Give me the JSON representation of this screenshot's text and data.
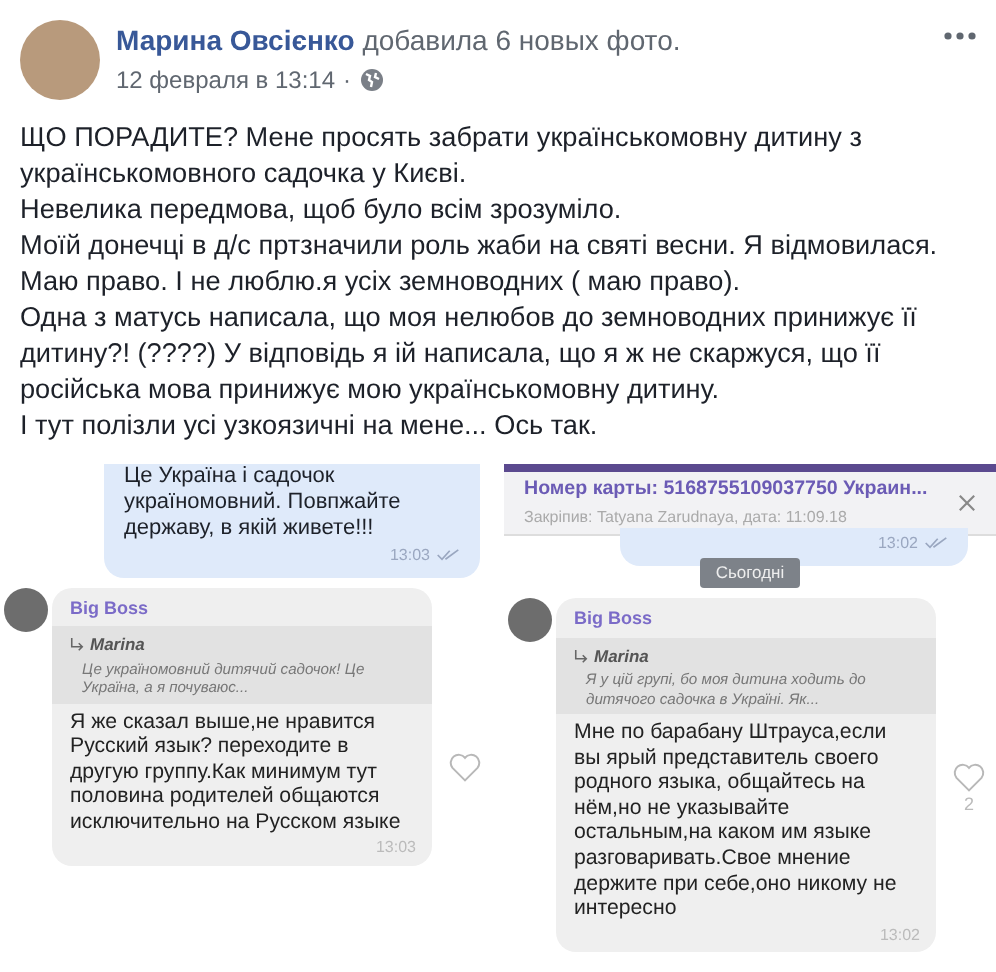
{
  "post": {
    "author": "Марина Овсієнко",
    "action": "добавила 6 новых фото.",
    "date": "12 февраля в 13:14",
    "separator": "·",
    "paragraphs": [
      "ЩО ПОРАДИТЕ? Мене просять забрати українськомовну дитину з українськомовного садочка у Києві.",
      "Невелика передмова, щоб було всім зрозуміло.",
      "Моїй донечці в д/с пртзначили роль жаби на святі весни. Я відмовилася.",
      "Маю право. І не люблю.я усіх земноводних ( маю право).",
      "Одна з матусь написала, що моя нелюбов до земноводних принижує її дитину?! (????) У відповідь я ій написала, що я ж не скаржуся, що її російська мова принижує мою українськомовну дитину.",
      "І тут полізли усі узкоязичні на мене... Ось так."
    ]
  },
  "screenshots": [
    {
      "outgoing": {
        "lines": [
          "Це Україна і садочок",
          "україномовний. Повпжайте державу, в якій живете!!!"
        ],
        "time": "13:03"
      },
      "incoming": {
        "sender": "Big Boss",
        "quote_author": "Marina",
        "quote_text": "Це україномовний дитячий садочок! Це Україна, а я почуваюс...",
        "text": "Я же сказал выше,не нравится Русский язык? переходите в другую группу.Как минимум тут половина родителей общаются исключительно на Русском языке",
        "time": "13:03"
      }
    },
    {
      "pinned": {
        "title": "Номер карты: 5168755109037750 Украин...",
        "subtitle": "Закріпив: Tatyana Zarudnaya, дата: 11:09.18"
      },
      "date_pill": "Сьогодні",
      "outgoing": {
        "time": "13:02"
      },
      "incoming": {
        "sender": "Big Boss",
        "quote_author": "Marina",
        "quote_text": "Я у цій групі, бо моя дитина ходить до дитячого садочка в Україні. Як...",
        "text": "Мне по барабану Штрауса,если вы ярый представитель своего родного языка, общайтесь на нём,но не указывайте остальным,на каком им языке разговаривать.Свое мнение держите при себе,оно никому не интересно",
        "time": "13:02",
        "likes": "2"
      }
    }
  ]
}
